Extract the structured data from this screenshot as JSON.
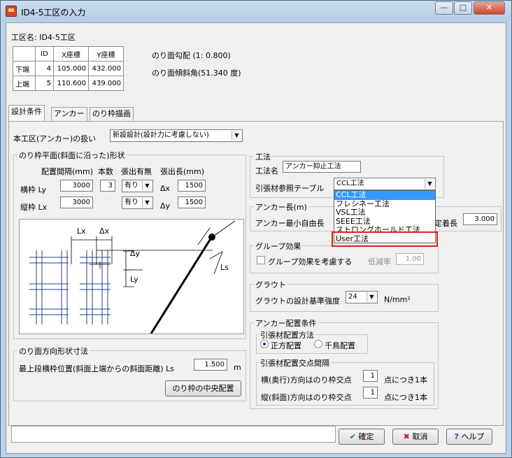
{
  "window": {
    "title": "ID4-5工区の入力",
    "minimize": "—",
    "maximize": "□",
    "close": "✕"
  },
  "header": {
    "section_name": "工区名: ID4-5工区",
    "table_headers": [
      "",
      "ID",
      "X座標",
      "Y座標"
    ],
    "rows": [
      [
        "下端",
        "4",
        "105.000",
        "432.000"
      ],
      [
        "上端",
        "5",
        "110.600",
        "439.000"
      ]
    ],
    "slope_ratio": "のり面勾配 (1: 0.800)",
    "slope_angle": "のり面傾斜角(51.340 度)"
  },
  "tabs": [
    "設計条件",
    "アンカー",
    "のり枠描画"
  ],
  "anchor_handling": {
    "label": "本工区(アンカー)の扱い",
    "value": "新設設計(設計力に考慮しない)"
  },
  "frame_shape": {
    "legend": "のり枠平面(斜面に沿った)形状",
    "col_spacing": "配置間隔(mm)",
    "col_count": "本数",
    "col_overhang": "張出有無",
    "col_overhang_len": "張出長(mm)",
    "row1_label": "横枠 Ly",
    "row1_spacing": "3000",
    "row1_count": "3",
    "row1_overhang": "有り",
    "row1_delta_label": "Δx",
    "row1_overhang_len": "1500",
    "row2_label": "縦枠 Lx",
    "row2_spacing": "3000",
    "row2_overhang": "有り",
    "row2_delta_label": "Δy",
    "row2_overhang_len": "1500"
  },
  "diagram": {
    "lx": "Lx",
    "dx": "Δx",
    "dy": "Δy",
    "ly": "Ly",
    "ls": "Ls"
  },
  "slope_direction": {
    "legend": "のり面方向形状寸法",
    "label": "最上段横枠位置(斜面上端からの斜面距離) Ls",
    "value": "1.500",
    "unit": "m",
    "center_button": "のり枠の中央配置"
  },
  "method": {
    "legend": "工法",
    "name_label": "工法名",
    "name_value": "アンカー抑止工法",
    "table_label": "引張材参照テーブル",
    "table_value": "CCL工法",
    "options": [
      "CCL工法",
      "フレシネー工法",
      "VSL工法",
      "SEEE工法",
      "ストロングホールド工法",
      "User工法"
    ]
  },
  "anchor_length": {
    "legend": "アンカー長(m)",
    "free_label": "アンカー最小自由長",
    "fixed_label": "定着長",
    "fixed_value": "3.000"
  },
  "group_effect": {
    "legend": "グループ効果",
    "check_label": "グループ効果を考慮する",
    "rate_label": "低減率",
    "rate_value": "1.00"
  },
  "grout": {
    "legend": "グラウト",
    "label": "グラウトの設計基準強度",
    "value": "24",
    "unit": "N/mm²"
  },
  "anchor_layout": {
    "legend": "アンカー配置条件",
    "method_legend": "引張材配置方法",
    "square": "正方配置",
    "staggered": "千鳥配置",
    "intersect_legend": "引張材配置交点間隔",
    "horiz_label": "横(奥行)方向はのり枠交点",
    "horiz_value": "1",
    "horiz_suffix": "点につき1本",
    "vert_label": "縦(斜面)方向はのり枠交点",
    "vert_value": "1",
    "vert_suffix": "点につき1本"
  },
  "footer": {
    "ok": "確定",
    "cancel": "取消",
    "help": "ヘルプ"
  },
  "colors": {
    "frame_grid": "#1f3f8f",
    "highlight": "#e0201c",
    "selected": "#3399ff"
  }
}
